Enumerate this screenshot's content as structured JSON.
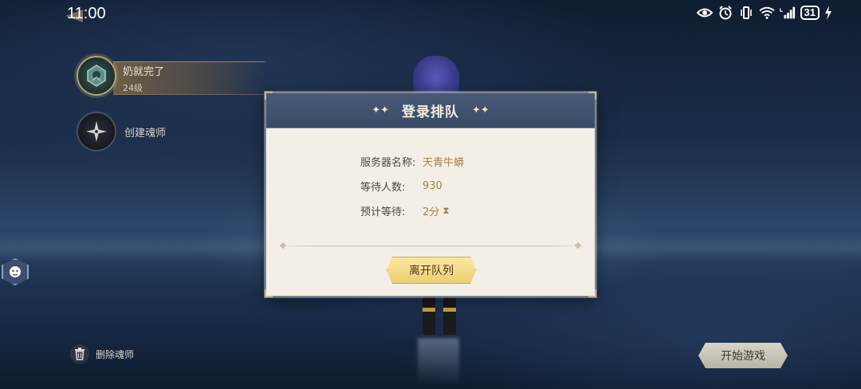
{
  "status_bar": {
    "time": "11:00",
    "battery": "31",
    "icons": [
      "eye-icon",
      "alarm-icon",
      "vibrate-icon",
      "wifi-icon",
      "signal-4g-icon",
      "battery-icon",
      "charging-icon"
    ]
  },
  "characters": {
    "selected": {
      "name": "奶就完了",
      "level": "24级"
    },
    "create_label": "创建魂师"
  },
  "delete_label": "删除魂师",
  "start_label": "开始游戏",
  "dialog": {
    "title": "登录排队",
    "rows": [
      {
        "label": "服务器名称:",
        "value": "天青牛蟒"
      },
      {
        "label": "等待人数:",
        "value": "930"
      },
      {
        "label": "预计等待:",
        "value": "2分"
      }
    ],
    "leave_button": "离开队列"
  },
  "colors": {
    "dialog_header": "#3a4b66",
    "dialog_body": "#f3efe6",
    "value_text": "#a77f48",
    "leave_button": "#eccf76",
    "start_button": "#c8c4b8"
  }
}
